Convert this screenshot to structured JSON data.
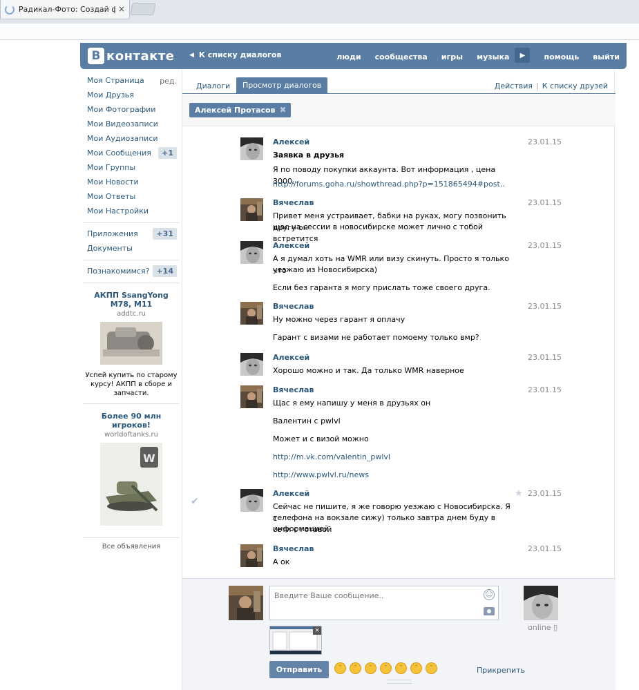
{
  "browser": {
    "tab_title": "Радикал-Фото: Создай ф",
    "tab_close": "×"
  },
  "header": {
    "logo_letter": "В",
    "logo_word": "контакте",
    "back_link": "К списку диалогов",
    "nav": [
      "люди",
      "сообщества",
      "игры",
      "музыка",
      "помощь",
      "выйти"
    ]
  },
  "sidebar": {
    "items": [
      {
        "label": "Моя Страница",
        "extra": "ред."
      },
      {
        "label": "Мои Друзья"
      },
      {
        "label": "Мои Фотографии"
      },
      {
        "label": "Мои Видеозаписи"
      },
      {
        "label": "Мои Аудиозаписи"
      },
      {
        "label": "Мои Сообщения",
        "badge": "+1"
      },
      {
        "label": "Мои Группы"
      },
      {
        "label": "Мои Новости"
      },
      {
        "label": "Мои Ответы"
      },
      {
        "label": "Мои Настройки"
      }
    ],
    "apps": {
      "label": "Приложения",
      "badge": "+31"
    },
    "docs": {
      "label": "Документы"
    },
    "dating": {
      "label": "Познакомимся?",
      "badge": "+14"
    },
    "ads": [
      {
        "title": "АКПП SsangYong M78, M11",
        "domain": "addtc.ru",
        "desc": "Успей купить по старому курсу! АКПП в сборе и запчасти."
      },
      {
        "title": "Более 90 млн игроков!",
        "domain": "worldoftanks.ru",
        "desc": ""
      }
    ],
    "all_ads": "Все объявления"
  },
  "tabs": {
    "dialogs": "Диалоги",
    "view": "Просмотр диалогов",
    "actions": "Действия",
    "to_friends": "К списку друзей",
    "separator": "|"
  },
  "filter": {
    "person": "Алексей Протасов",
    "remove": "✖"
  },
  "messages": [
    {
      "author": "Алексей",
      "date": "23.01.15",
      "lines": [
        {
          "text": "Заявка в друзья",
          "style": "bold"
        },
        {
          "text": "Я по поводу покупки аккаунта. Вот информация , цена 3000."
        },
        {
          "text": "http://forums.goha.ru/showthread.php?p=151865494#post..",
          "style": "link"
        }
      ]
    },
    {
      "author": "Вячеслав",
      "date": "23.01.15",
      "lines": [
        {
          "text": "Привет меня устраивает, бабки на руках, могу позвонить другу он"
        },
        {
          "text": "щас на сессии в новосибирске может лично с тобой встретится"
        }
      ]
    },
    {
      "author": "Алексей",
      "date": "23.01.15",
      "lines": [
        {
          "text": "А я думал хоть на WMR или визу скинуть. Просто я только что"
        },
        {
          "text": "уезжаю из Новосибирска)"
        },
        {
          "text": "Если без гаранта я могу прислать тоже своего друга."
        }
      ]
    },
    {
      "author": "Вячеслав",
      "date": "23.01.15",
      "lines": [
        {
          "text": "Ну можно через гарант я оплачу"
        },
        {
          "text": "Гарант с визами не работает помоему только вмр?"
        }
      ]
    },
    {
      "author": "Алексей",
      "date": "23.01.15",
      "lines": [
        {
          "text": "Хорошо можно и так. Да только WMR наверное"
        }
      ]
    },
    {
      "author": "Вячеслав",
      "date": "23.01.15",
      "lines": [
        {
          "text": "Щас я ему напишу у меня в друзьях он"
        },
        {
          "text": "Валентин с pwlvl"
        },
        {
          "text": "Может и с визой можно"
        },
        {
          "text": "http://m.vk.com/valentin_pwlvl",
          "style": "link"
        },
        {
          "text": "http://www.pwlvl.ru/news",
          "style": "link"
        }
      ]
    },
    {
      "author": "Алексей",
      "date": "23.01.15",
      "lines": [
        {
          "text": "Сейчас не пишите, я же говорю уезжаю с Новосибирска. Я с"
        },
        {
          "text": "телефона на вокзале сижу) только завтра днем буду в сети с готовой"
        },
        {
          "text": "информацией"
        }
      ]
    },
    {
      "author": "Вячеслав",
      "date": "23.01.15",
      "lines": [
        {
          "text": "А ок"
        }
      ]
    }
  ],
  "compose": {
    "placeholder": "Введите Ваше сообщение..",
    "send": "Отправить",
    "attach": "Прикрепить",
    "online": "online",
    "thumb_close": "×"
  },
  "colors": {
    "brand": "#597da3",
    "link": "#2b587a"
  }
}
